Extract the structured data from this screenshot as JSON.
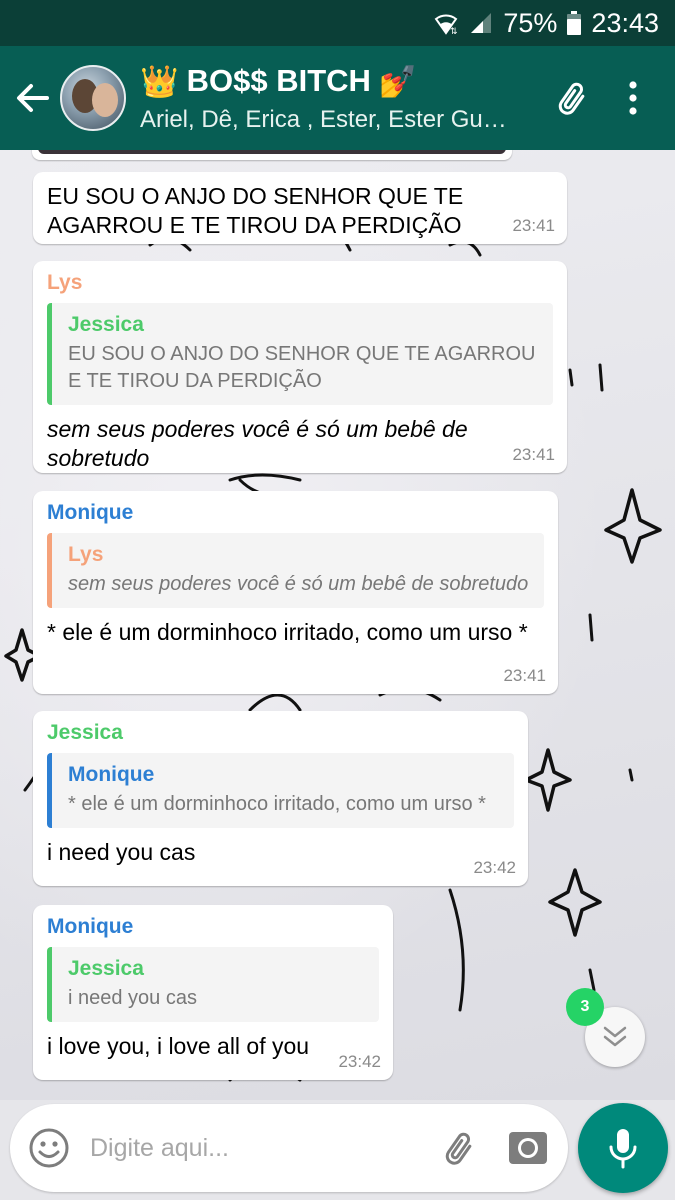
{
  "status_bar": {
    "battery": "75%",
    "time": "23:43"
  },
  "toolbar": {
    "title": "BO$$ BITCH",
    "title_prefix_emoji": "👑",
    "title_suffix_emoji": "💅",
    "participants": "Ariel, Dê, Erica , Ester, Ester Gued..."
  },
  "messages": [
    {
      "text": "EU SOU O ANJO DO SENHOR QUE TE AGARROU E TE TIROU DA PERDIÇÃO",
      "time": "23:41"
    },
    {
      "sender": "Lys",
      "quote_name": "Jessica",
      "quote_text": "EU SOU O ANJO DO SENHOR QUE TE AGARROU E TE TIROU DA PERDIÇÃO",
      "text": "sem seus poderes você é só um bebê de sobretudo",
      "time": "23:41"
    },
    {
      "sender": "Monique",
      "quote_name": "Lys",
      "quote_text": "sem seus poderes você é só um bebê de sobretudo",
      "text": "* ele é um dorminhoco irritado, como um urso *",
      "time": "23:41"
    },
    {
      "sender": "Jessica",
      "quote_name": "Monique",
      "quote_text": "* ele é um dorminhoco irritado, como um urso *",
      "text": "i need you cas",
      "time": "23:42"
    },
    {
      "sender": "Monique",
      "quote_name": "Jessica",
      "quote_text": "i need you cas",
      "text": "i love you, i love all of you",
      "time": "23:42"
    }
  ],
  "unread_count": "3",
  "composer": {
    "placeholder": "Digite aqui..."
  },
  "colors": {
    "status_bar": "#0b3f37",
    "toolbar": "#075e54",
    "lys": "#f5a27a",
    "monique": "#2d7fd3",
    "jessica": "#4dca6a",
    "mic_button": "#00897b",
    "unread_badge": "#25d366"
  },
  "icons": {
    "back": "arrow-left-icon",
    "attach": "paperclip-icon",
    "menu": "more-vert-icon",
    "emoji": "smiley-icon",
    "camera": "camera-icon",
    "mic": "mic-icon",
    "scroll_down": "chevron-double-down-icon",
    "wifi": "wifi-icon",
    "signal": "signal-icon",
    "battery": "battery-icon"
  }
}
